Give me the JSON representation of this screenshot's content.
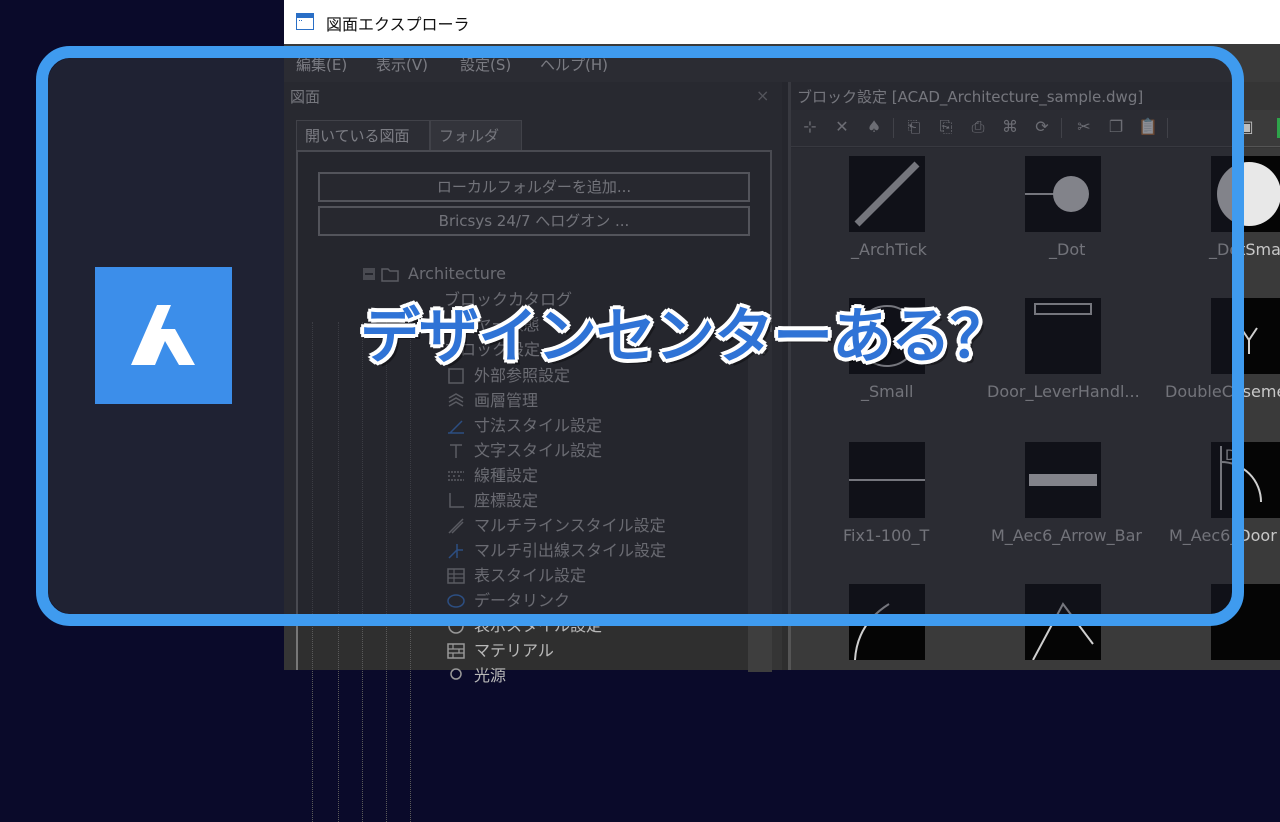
{
  "window": {
    "title": "図面エクスプローラ"
  },
  "menu": [
    "編集(E)",
    "表示(V)",
    "設定(S)",
    "ヘルプ(H)"
  ],
  "left_panel": {
    "title": "図面",
    "close": "×",
    "tabs": [
      "開いている図面",
      "フォルダー"
    ],
    "buttons": [
      "ローカルフォルダーを追加...",
      "Bricsys 24/7 へログオン ..."
    ],
    "tree": [
      "Architecture",
      "ブロックカタログ",
      "レイヤー状態",
      "ブロック設定",
      "外部参照設定",
      "画層管理",
      "寸法スタイル設定",
      "文字スタイル設定",
      "線種設定",
      "座標設定",
      "マルチラインスタイル設定",
      "マルチ引出線スタイル設定",
      "表スタイル設定",
      "データリンク",
      "表示スタイル設定",
      "マテリアル",
      "光源"
    ]
  },
  "right_panel": {
    "title": "ブロック設定 [ACAD_Architecture_sample.dwg]",
    "blocks": [
      "_ArchTick",
      "_Dot",
      "_DotSmall",
      "_Small",
      "Door_LeverHandl...",
      "DoubleCaseme...",
      "Fix1-100_T",
      "M_Aec6_Arrow_Bar",
      "M_Aec6_Door",
      "",
      "",
      ""
    ]
  },
  "overlay": {
    "headline": "デザインセンターある？",
    "accent_color": "#3f9bef",
    "logo_color": "#3c8eea"
  }
}
